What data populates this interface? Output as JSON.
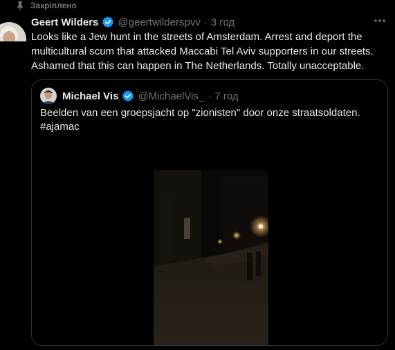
{
  "pinned": {
    "label": "Закріплено"
  },
  "tweet": {
    "author_name": "Geert Wilders",
    "handle": "@geertwilderspvv",
    "separator": "·",
    "time": "3 год",
    "text": "Looks like a Jew hunt in the streets of Amsterdam. Arrest and deport  the multicultural scum that attacked Maccabi Tel Aviv supporters in our streets. Ashamed that this can happen in The Netherlands. Totally unacceptable."
  },
  "quote": {
    "author_name": "Michael Vis",
    "handle": "@MichaelVis_",
    "separator": "·",
    "time": "7 год",
    "text_line1": "Beelden van een groepsjacht op \"zionisten\" door onze straatsoldaten.",
    "hashtag": "#ajamac"
  },
  "icons": {
    "pin": "pin-icon",
    "verified": "verified-badge-icon",
    "more": "more-options-icon"
  },
  "colors": {
    "background": "#000000",
    "text": "#e7e9ea",
    "secondary": "#71767b",
    "verified": "#1d9bf0",
    "border": "#2f3336"
  }
}
